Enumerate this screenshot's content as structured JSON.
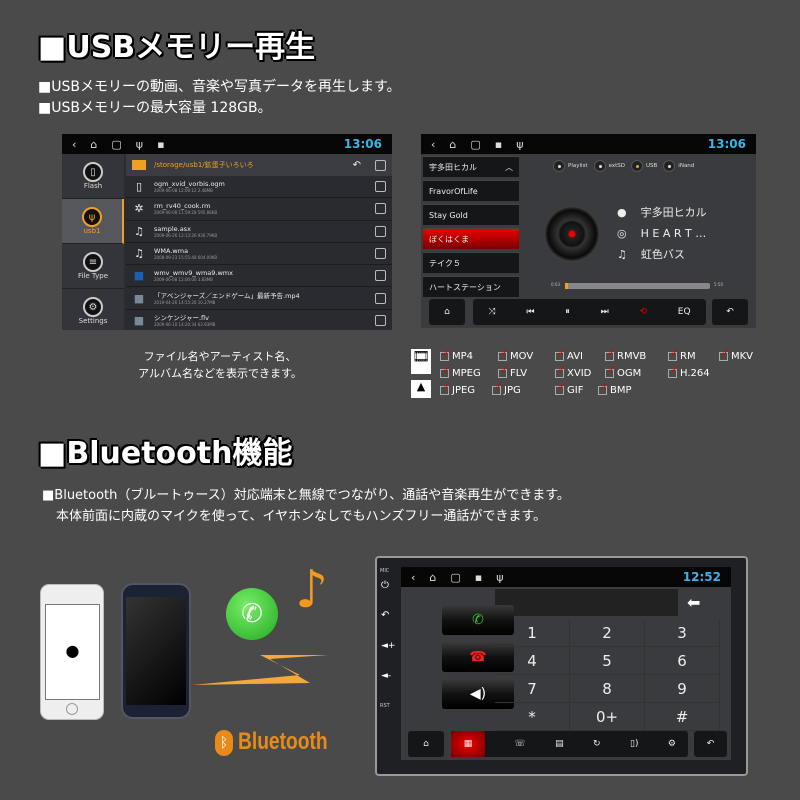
{
  "usb_section": {
    "title": "■USBメモリー再生",
    "lines": [
      "■USBメモリーの動画、音楽や写真データを再生します。",
      "■USBメモリーの最大容量 128GB。"
    ]
  },
  "file_screen": {
    "time": "13:06",
    "path": "/storage/usb1/鉱蛋子いろいろ",
    "sidebar": [
      {
        "label": "Flash",
        "icon": "flash-icon"
      },
      {
        "label": "usb1",
        "icon": "usb-icon",
        "active": true
      },
      {
        "label": "File Type",
        "icon": "list-icon"
      },
      {
        "label": "Settings",
        "icon": "gear-icon"
      }
    ],
    "files": [
      {
        "name": "ogm_xvid_vorbis.ogm",
        "meta": "2009-06-08 12:00:12  2.48MB",
        "icon": "unknown-file-icon"
      },
      {
        "name": "rm_rv40_cook.rm",
        "meta": "2009-06-08 11:59:28  595.86KB",
        "icon": "film-reel-icon"
      },
      {
        "name": "sample.asx",
        "meta": "2009-06-26 12:13:26  936.79KB",
        "icon": "music-note-icon"
      },
      {
        "name": "WMA.wma",
        "meta": "2008-09-23 15:55:48  604.09KB",
        "icon": "music-note-icon"
      },
      {
        "name": "wmv_wmv9_wma9.wmx",
        "meta": "2009-06-08 12:00:00  3.83MB",
        "icon": "video-thumb-icon"
      },
      {
        "name": "「アベンジャーズ／エンドゲーム」最新予告.mp4",
        "meta": "2019-04-26 14:55:26  10.27MB",
        "icon": "video-thumb-icon"
      },
      {
        "name": "シンケンジャー.flv",
        "meta": "2009-06-10 14:20:34  63.93MB",
        "icon": "video-thumb-icon"
      }
    ]
  },
  "music_screen": {
    "time": "13:06",
    "playlist": [
      "宇多田ヒカル",
      "FravorOfLife",
      "Stay Gold",
      "ぼくはくま",
      "テイク５",
      "ハートステーション"
    ],
    "active_index": 3,
    "sources": [
      {
        "label": "Playlist",
        "on": false
      },
      {
        "label": "extSD",
        "on": false
      },
      {
        "label": "USB",
        "on": true
      },
      {
        "label": "iNand",
        "on": false
      }
    ],
    "artist": "宇多田ヒカル",
    "album": "H E A R T  …",
    "title": "虹色バス",
    "elapsed": "0:03",
    "duration": "5:50",
    "progress": 0.01,
    "eq_label": "EQ"
  },
  "caption": [
    "ファイル名やアーティスト名、",
    "アルバム名などを表示できます。"
  ],
  "formats": {
    "video": [
      [
        "MP4",
        "MOV",
        "AVI",
        "RMVB",
        "RM",
        "MKV"
      ],
      [
        "MPEG",
        "FLV",
        "XVID",
        "OGM",
        "H.264"
      ]
    ],
    "image": [
      "JPEG",
      "JPG",
      "GIF",
      "BMP"
    ]
  },
  "bt_section": {
    "title": "■Bluetooth機能",
    "lines": [
      "■Bluetooth（ブルートゥース）対応端末と無線でつながり、通話や音楽再生ができます。",
      "本体前面に内蔵のマイクを使って、イヤホンなしでもハンズフリー通話ができます。"
    ],
    "logo_text": "Bluetooth"
  },
  "phone_screen": {
    "time": "12:52",
    "keys": [
      "1",
      "2",
      "3",
      "4",
      "5",
      "6",
      "7",
      "8",
      "9",
      "*",
      "0+",
      "#"
    ],
    "side_labels": [
      "MIC",
      "RST"
    ]
  },
  "colors": {
    "background": "#4a4a4a",
    "accent_orange": "#f0a020",
    "clock_blue": "#3ab4e6",
    "active_red": "#e00000"
  }
}
